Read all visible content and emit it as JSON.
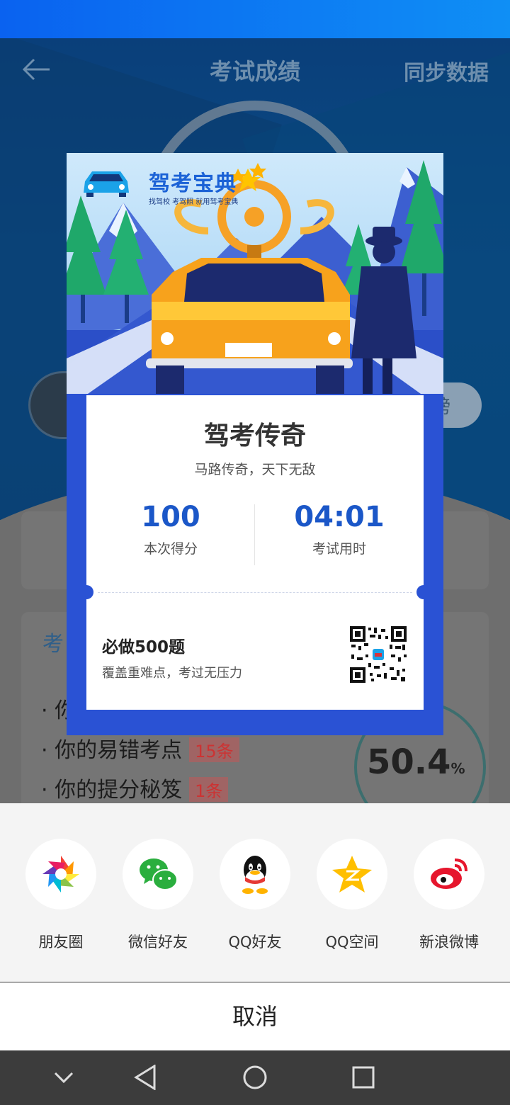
{
  "header": {
    "title": "考试成绩",
    "sync_label": "同步数据"
  },
  "background": {
    "pill_text": "榜",
    "section_title": "考",
    "items": [
      {
        "text": "你",
        "badge": ""
      },
      {
        "text": "你的易错考点",
        "badge": "15条"
      },
      {
        "text": "你的提分秘笈",
        "badge": "1条"
      }
    ],
    "accuracy": "50.4",
    "accuracy_unit": "%"
  },
  "poster": {
    "logo_title": "驾考宝典",
    "logo_sub": "找驾校 考驾照 就用驾考宝典",
    "plate_text": "",
    "title": "驾考传奇",
    "subtitle": "马路传奇，天下无敌",
    "score_value": "100",
    "score_label": "本次得分",
    "time_value": "04:01",
    "time_label": "考试用时",
    "promo_title": "必做500题",
    "promo_sub": "覆盖重难点，考过无压力"
  },
  "share": {
    "targets": [
      {
        "label": "朋友圈",
        "icon": "moments-icon"
      },
      {
        "label": "微信好友",
        "icon": "wechat-icon"
      },
      {
        "label": "QQ好友",
        "icon": "qq-icon"
      },
      {
        "label": "QQ空间",
        "icon": "qzone-icon"
      },
      {
        "label": "新浪微博",
        "icon": "weibo-icon"
      }
    ],
    "cancel_label": "取消"
  },
  "colors": {
    "accent": "#1b57c8",
    "poster_bg": "#2a52d4",
    "status_bar": "#0a62f0"
  }
}
